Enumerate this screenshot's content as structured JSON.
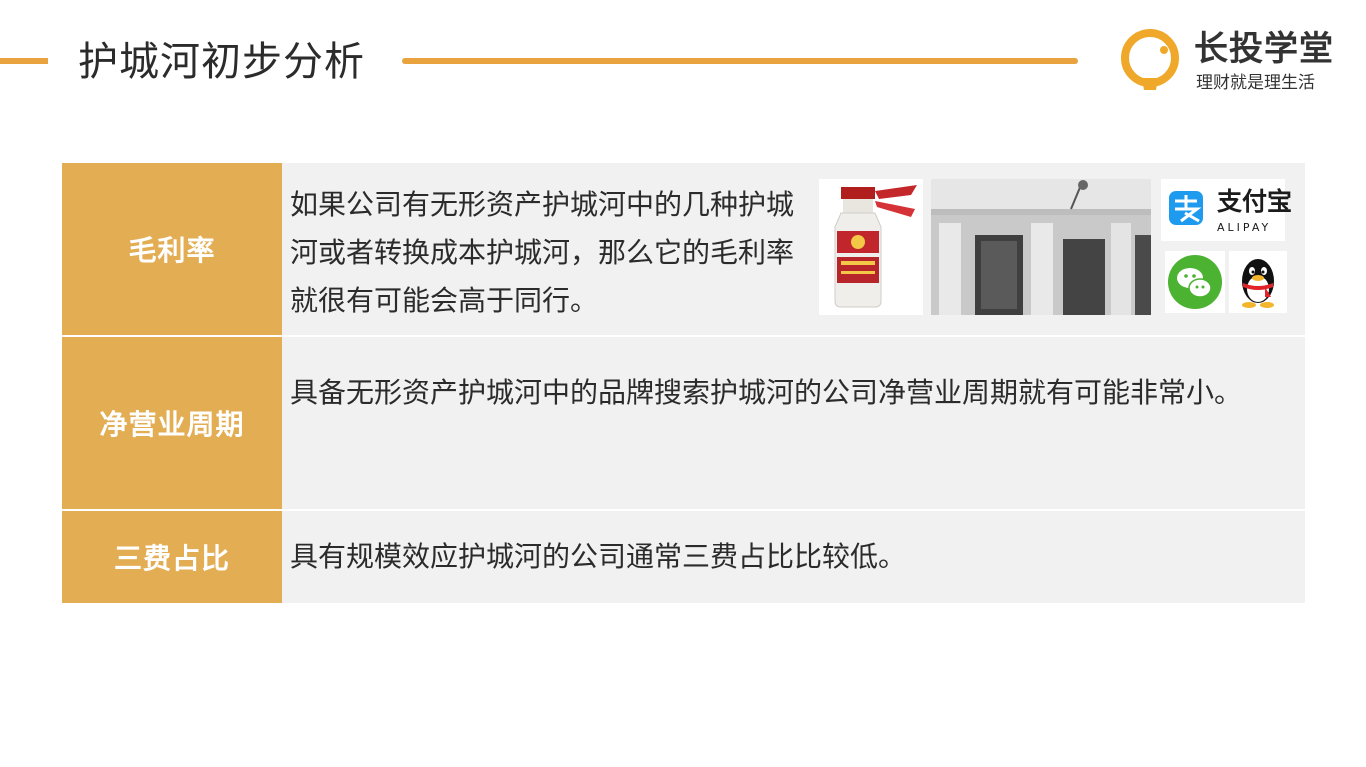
{
  "header": {
    "title": "护城河初步分析"
  },
  "brand": {
    "name": "长投学堂",
    "slogan": "理财就是理生活",
    "accent": "#e8a23e"
  },
  "rows": [
    {
      "label": "毛利率",
      "text": "如果公司有无形资产护城河中的几种护城河或者转换成本护城河，那么它的毛利率就很有可能会高于同行。"
    },
    {
      "label": "净营业周期",
      "text": "具备无形资产护城河中的品牌搜索护城河的公司净营业周期就有可能非常小。"
    },
    {
      "label": "三费占比",
      "text": "具有规模效应护城河的公司通常三费占比比较低。"
    }
  ],
  "images": {
    "alipay_name": "支付宝",
    "alipay_en": "ALIPAY",
    "icons": [
      "baijiu-bottle-image",
      "bank-of-china-image",
      "alipay-logo",
      "wechat-logo",
      "qq-logo"
    ]
  },
  "colors": {
    "label_bg": "#e3ad53",
    "row_bg": "#f1f1f1",
    "alipay_blue": "#1e9bef",
    "wechat_green": "#4bb232"
  }
}
